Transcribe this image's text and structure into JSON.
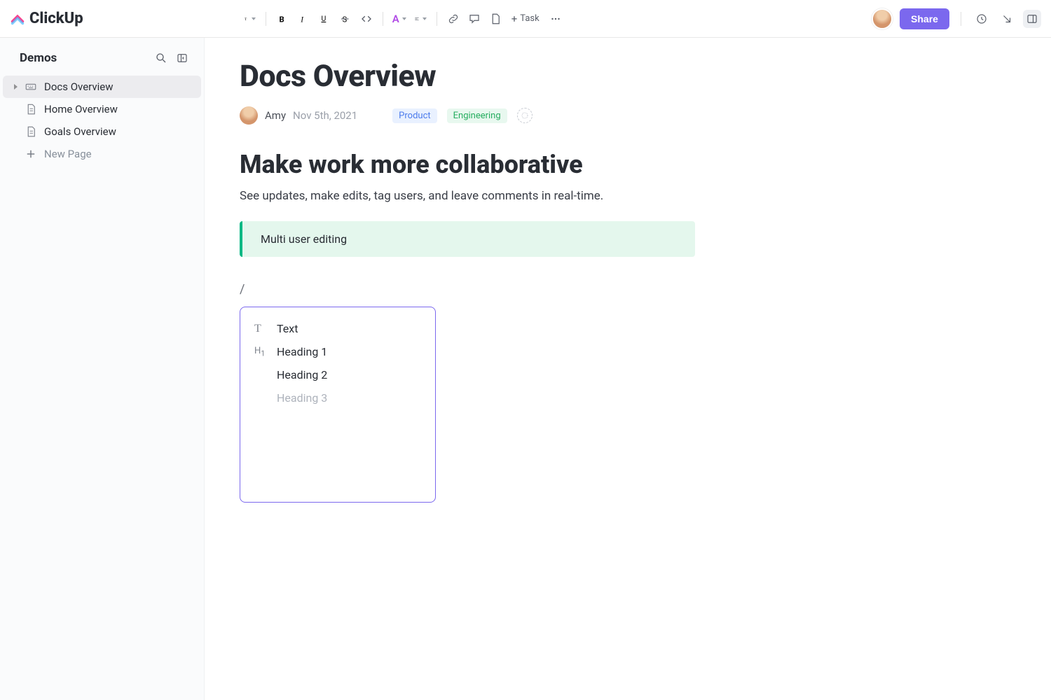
{
  "brand": "ClickUp",
  "toolbar": {
    "task_label": "Task",
    "share_label": "Share"
  },
  "sidebar": {
    "title": "Demos",
    "items": [
      {
        "label": "Docs Overview",
        "icon": "keyboard",
        "active": true
      },
      {
        "label": "Home Overview",
        "icon": "doc",
        "active": false
      },
      {
        "label": "Goals Overview",
        "icon": "doc",
        "active": false
      }
    ],
    "new_label": "New Page"
  },
  "doc": {
    "title": "Docs Overview",
    "author": "Amy",
    "date": "Nov 5th, 2021",
    "tags": [
      "Product",
      "Engineering"
    ],
    "heading": "Make work more collaborative",
    "body": "See updates, make edits, tag users, and leave comments in real-time.",
    "callout": "Multi user editing",
    "slash": "/"
  },
  "cmd_menu": [
    {
      "label": "Text",
      "icon": "T"
    },
    {
      "label": "Heading 1",
      "icon": "H1"
    },
    {
      "label": "Heading 2",
      "icon": ""
    },
    {
      "label": "Heading 3",
      "icon": "",
      "faded": true
    }
  ]
}
